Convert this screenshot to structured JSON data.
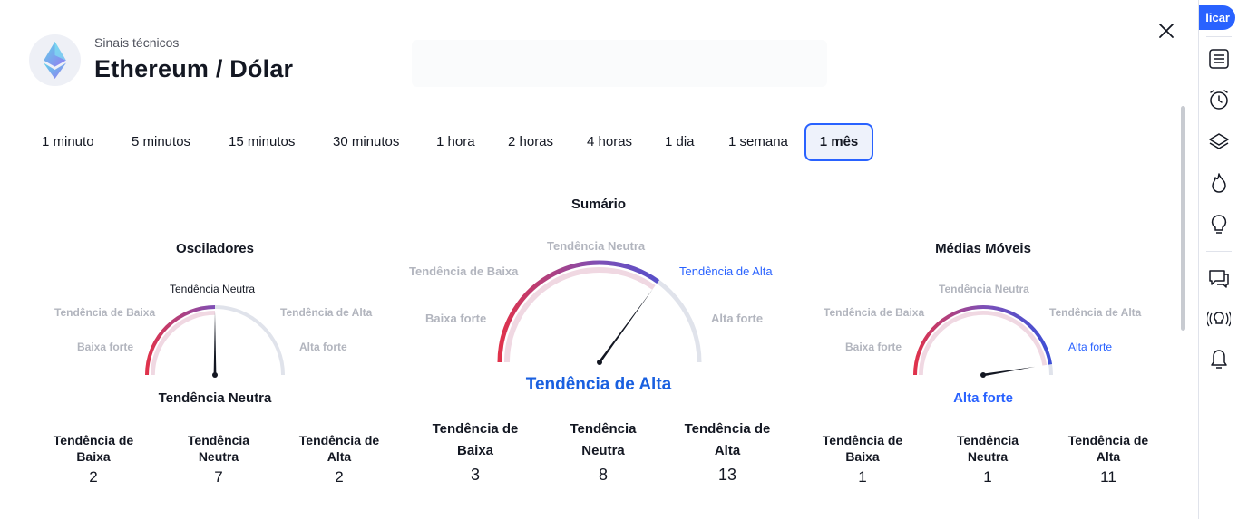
{
  "header": {
    "subtitle": "Sinais técnicos",
    "title": "Ethereum / Dólar",
    "logo_icon": "ethereum-icon"
  },
  "toolbar": {
    "publish_label": "licar",
    "icons": [
      "watchlist-icon",
      "alert-clock-icon",
      "layers-icon",
      "hotlist-flame-icon",
      "ideas-lightbulb-icon",
      "chat-icon",
      "streams-icon",
      "notifications-bell-icon"
    ]
  },
  "intervals": [
    {
      "label": "1 minuto",
      "active": false
    },
    {
      "label": "5 minutos",
      "active": false
    },
    {
      "label": "15 minutos",
      "active": false
    },
    {
      "label": "30 minutos",
      "active": false
    },
    {
      "label": "1 hora",
      "active": false
    },
    {
      "label": "2 horas",
      "active": false
    },
    {
      "label": "4 horas",
      "active": false
    },
    {
      "label": "1 dia",
      "active": false
    },
    {
      "label": "1 semana",
      "active": false
    },
    {
      "label": "1 mês",
      "active": true
    }
  ],
  "oscillators": {
    "title": "Osciladores",
    "labels": {
      "strong_sell": "Baixa forte",
      "sell": "Tendência de Baixa",
      "neutral": "Tendência Neutra",
      "buy": "Tendência de Alta",
      "strong_buy": "Alta forte"
    },
    "result": "Tendência Neutra",
    "needle_level": 0.5,
    "counts": [
      {
        "label": "Tendência de Baixa",
        "value": "2"
      },
      {
        "label": "Tendência Neutra",
        "value": "7"
      },
      {
        "label": "Tendência de Alta",
        "value": "2"
      }
    ]
  },
  "summary": {
    "title": "Sumário",
    "labels": {
      "strong_sell": "Baixa forte",
      "sell": "Tendência de Baixa",
      "neutral": "Tendência Neutra",
      "buy": "Tendência de Alta",
      "strong_buy": "Alta forte"
    },
    "result": "Tendência de Alta",
    "needle_level": 0.7,
    "counts": [
      {
        "label": "Tendência de Baixa",
        "value": "3"
      },
      {
        "label": "Tendência Neutra",
        "value": "8"
      },
      {
        "label": "Tendência de Alta",
        "value": "13"
      }
    ]
  },
  "moving_averages": {
    "title": "Médias Móveis",
    "labels": {
      "strong_sell": "Baixa forte",
      "sell": "Tendência de Baixa",
      "neutral": "Tendência Neutra",
      "buy": "Tendência de Alta",
      "strong_buy": "Alta forte"
    },
    "result": "Alta forte",
    "needle_level": 0.95,
    "counts": [
      {
        "label": "Tendência de Baixa",
        "value": "1"
      },
      {
        "label": "Tendência Neutra",
        "value": "1"
      },
      {
        "label": "Tendência de Alta",
        "value": "11"
      }
    ]
  },
  "colors": {
    "accent": "#2962ff",
    "sell_red": "#e0324b",
    "neutral_purple": "#7e4fb6",
    "buy_blue": "#3d4fd6",
    "track_gray": "#e0e3eb"
  }
}
